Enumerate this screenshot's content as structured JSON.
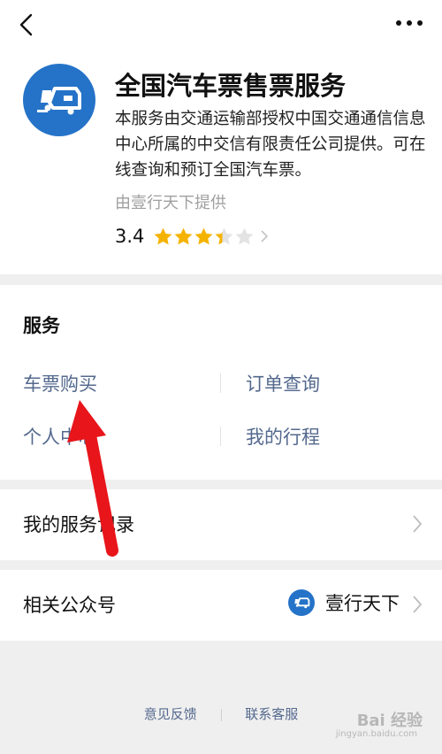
{
  "app": {
    "title": "全国汽车票售票服务",
    "description": "本服务由交通运输部授权中国交通通信信息中心所属的中交信有限责任公司提供。可在线查询和预订全国汽车票。",
    "provider": "由壹行天下提供",
    "rating": "3.4",
    "rating_value": 3.4,
    "rating_max": 5,
    "logo_icon": "bus-logo-icon",
    "brand_color": "#2573c8"
  },
  "services": {
    "title": "服务",
    "items": [
      "车票购买",
      "订单查询",
      "个人中心",
      "我的行程"
    ]
  },
  "rows": {
    "records": "我的服务记录",
    "official": "相关公众号",
    "account_name": "壹行天下"
  },
  "footer": {
    "feedback": "意见反馈",
    "support": "联系客服"
  },
  "watermark": {
    "text": "Bai 经验",
    "url": "jingyan.baidu.com"
  },
  "colors": {
    "link": "#54698e",
    "star": "#f5b301",
    "star_empty": "#e3e3e3",
    "annotation_arrow": "#e8151b"
  }
}
